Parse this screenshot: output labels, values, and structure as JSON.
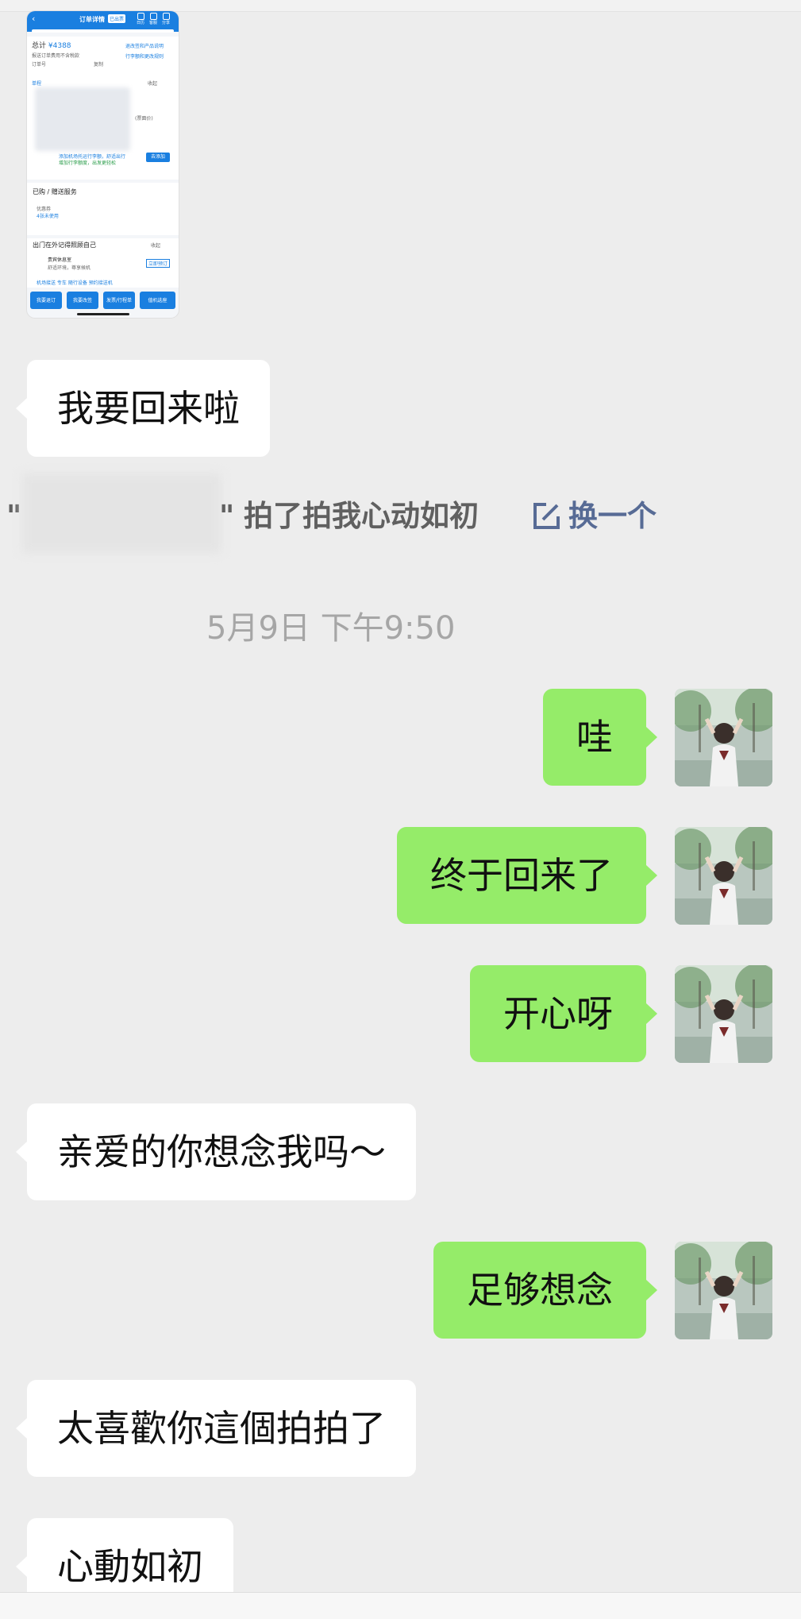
{
  "thumbnail": {
    "header_title": "订单详情",
    "header_tag": "已出票",
    "header_icons": [
      "日历",
      "客服",
      "分享"
    ],
    "total_label": "总计",
    "total_value": "¥4388",
    "total_link": "退改签和产品说明",
    "order_note": "报送订单费用不含税款",
    "order_link": "行李额和更改规则",
    "order_no_label": "订单号",
    "copy_label": "复制",
    "section_tag": "单程",
    "collapse": "收起",
    "price_note": "(票面价)",
    "add_promo": "添加机场托运行李额，舒适出行",
    "add_promo_sub": "增加行李额度，出发更轻松",
    "add_button": "去添加",
    "bought_title": "已购 / 赠送服务",
    "coupon_label": "优惠券",
    "coupon_sub": "4张未使用",
    "care_title": "出门在外记得照顾自己",
    "care_collapse": "收起",
    "care_item": "贵宾休息室",
    "care_sub": "舒适环境，尊享候机",
    "care_btn": "立即预订",
    "care_items": "机场接送  专车  随行设备  预约接送机",
    "buttons": [
      "我要退订",
      "我要改签",
      "发票/行程单",
      "值机选座"
    ]
  },
  "messages": [
    {
      "side": "in",
      "text": "我要回来啦"
    },
    {
      "side": "out",
      "text": "哇"
    },
    {
      "side": "out",
      "text": "终于回来了"
    },
    {
      "side": "out",
      "text": "开心呀"
    },
    {
      "side": "in",
      "text": "亲爱的你想念我吗～"
    },
    {
      "side": "out",
      "text": "足够想念"
    },
    {
      "side": "in",
      "text": "太喜歡你這個拍拍了"
    },
    {
      "side": "in",
      "text": "心動如初"
    }
  ],
  "pat": {
    "quote_open": "\"",
    "quote_close": "\"",
    "text": "拍了拍我心动如初",
    "action": "换一个"
  },
  "timestamp": "5月9日 下午9:50",
  "colors": {
    "background": "#ededed",
    "bubble_in": "#ffffff",
    "bubble_out": "#95ec69",
    "link": "#576b95"
  }
}
